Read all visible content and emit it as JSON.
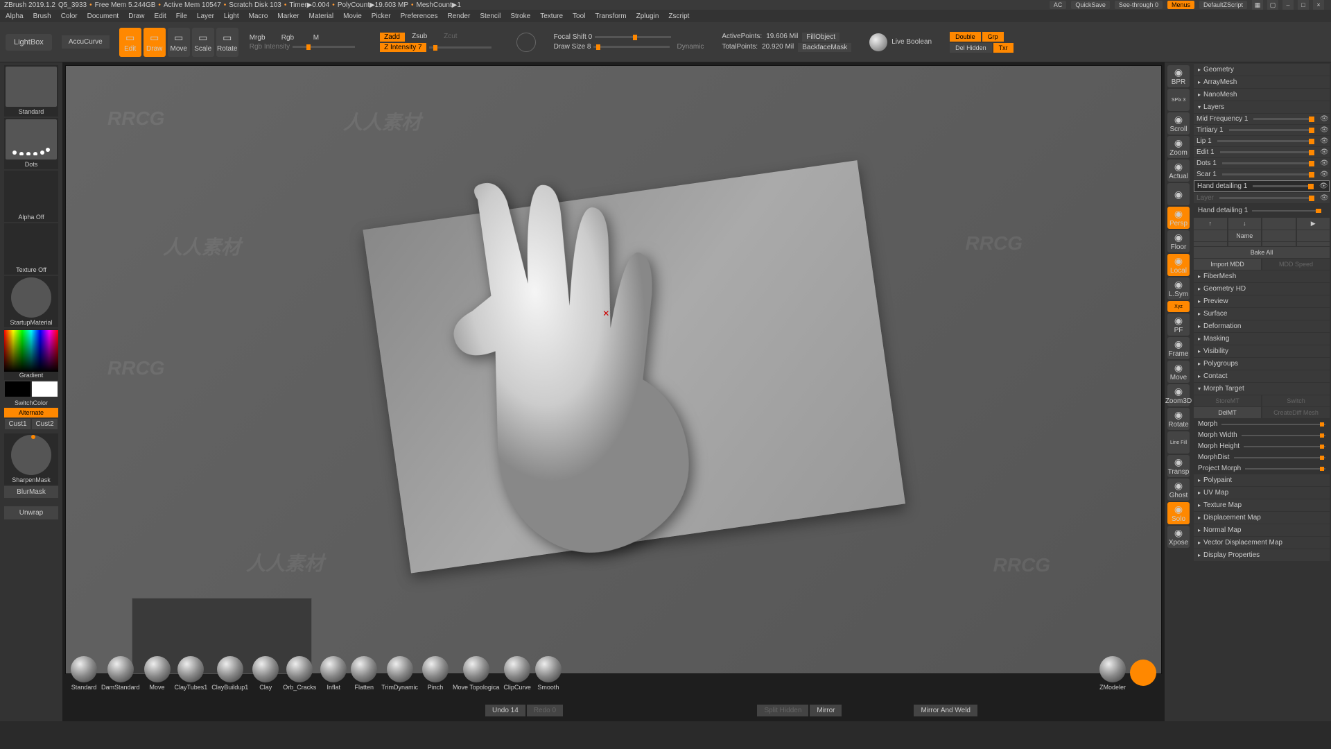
{
  "title": {
    "app": "ZBrush 2019.1.2",
    "file": "Q5_3933",
    "freemem": "Free Mem 5.244GB",
    "activemem": "Active Mem 10547",
    "scratch": "Scratch Disk 103",
    "timer": "Timer▶0.004",
    "polycount": "PolyCount▶19.603 MP",
    "meshcount": "MeshCount▶1"
  },
  "topright": {
    "ac": "AC",
    "quicksave": "QuickSave",
    "seethrough": "See-through  0",
    "menus": "Menus",
    "script": "DefaultZScript"
  },
  "menu": [
    "Alpha",
    "Brush",
    "Color",
    "Document",
    "Draw",
    "Edit",
    "File",
    "Layer",
    "Light",
    "Macro",
    "Marker",
    "Material",
    "Movie",
    "Picker",
    "Preferences",
    "Render",
    "Stencil",
    "Stroke",
    "Texture",
    "Tool",
    "Transform",
    "Zplugin",
    "Zscript"
  ],
  "toolbar": {
    "lightbox": "LightBox",
    "accucurve": "AccuCurve",
    "modes": [
      {
        "label": "Edit",
        "active": true
      },
      {
        "label": "Draw",
        "active": true
      },
      {
        "label": "Move",
        "active": false
      },
      {
        "label": "Scale",
        "active": false
      },
      {
        "label": "Rotate",
        "active": false
      }
    ],
    "color_modes": {
      "mrgb": "Mrgb",
      "rgb": "Rgb",
      "m": "M",
      "rgbintensity": "Rgb Intensity"
    },
    "zmodes": {
      "zadd": "Zadd",
      "zsub": "Zsub",
      "zcut": "Zcut",
      "zintensity": "Z Intensity 7"
    },
    "focal": {
      "label": "Focal Shift 0",
      "draw": "Draw Size 8",
      "dynamic": "Dynamic"
    },
    "stats": {
      "active_lbl": "ActivePoints:",
      "active_val": "19.606 Mil",
      "fill": "FillObject",
      "total_lbl": "TotalPoints:",
      "total_val": "20.920 Mil",
      "backface": "BackfaceMask"
    },
    "livebool": "Live Boolean",
    "rt": {
      "double": "Double",
      "grp": "Grp",
      "delhidden": "Del Hidden",
      "txr": "Txr"
    }
  },
  "left": {
    "standard": "Standard",
    "dots": "Dots",
    "alphaoff": "Alpha Off",
    "textureoff": "Texture Off",
    "startup": "StartupMaterial",
    "gradient": "Gradient",
    "switchcolor": "SwitchColor",
    "alternate": "Alternate",
    "cust1": "Cust1",
    "cust2": "Cust2",
    "sharpen": "SharpenMask",
    "blur": "BlurMask",
    "unwrap": "Unwrap"
  },
  "brushes": [
    "Standard",
    "DamStandard",
    "Move",
    "ClayTubes1",
    "ClayBuildup1",
    "Clay",
    "Orb_Cracks",
    "Inflat",
    "Flatten",
    "TrimDynamic",
    "Pinch",
    "Move Topologica",
    "ClipCurve",
    "Smooth"
  ],
  "brushes_right": [
    "ZModeler",
    ""
  ],
  "undo": {
    "undo": "Undo 14",
    "redo": "Redo 0",
    "split": "Split Hidden",
    "mirror": "Mirror",
    "mirrorweld": "Mirror And Weld"
  },
  "righticons": [
    {
      "lbl": "BPR",
      "o": false
    },
    {
      "lbl": "SPix 3",
      "o": false,
      "text": true
    },
    {
      "lbl": "Scroll",
      "o": false
    },
    {
      "lbl": "Zoom",
      "o": false
    },
    {
      "lbl": "Actual",
      "o": false
    },
    {
      "lbl": "",
      "o": false,
      "lock": true
    },
    {
      "lbl": "Persp",
      "o": true,
      "outlined": true
    },
    {
      "lbl": "Floor",
      "o": false
    },
    {
      "lbl": "Local",
      "o": true
    },
    {
      "lbl": "L.Sym",
      "o": false
    },
    {
      "lbl": "Xyz",
      "o": true,
      "thin": true
    },
    {
      "lbl": "PF",
      "o": false
    },
    {
      "lbl": "Frame",
      "o": false
    },
    {
      "lbl": "Move",
      "o": false
    },
    {
      "lbl": "Zoom3D",
      "o": false
    },
    {
      "lbl": "Rotate",
      "o": false
    },
    {
      "lbl": "Line Fill",
      "o": false,
      "text": true
    },
    {
      "lbl": "Transp",
      "o": false
    },
    {
      "lbl": "Ghost",
      "o": false
    },
    {
      "lbl": "Solo",
      "o": true
    },
    {
      "lbl": "Xpose",
      "o": false
    }
  ],
  "panel": {
    "sections_top": [
      "Geometry",
      "ArrayMesh",
      "NanoMesh"
    ],
    "layers_hdr": "Layers",
    "layers": [
      {
        "name": "Mid Frequency 1",
        "sel": false
      },
      {
        "name": "Tirtiary 1",
        "sel": false
      },
      {
        "name": "Lip 1",
        "sel": false
      },
      {
        "name": "Edit 1",
        "sel": false
      },
      {
        "name": "Dots 1",
        "sel": false
      },
      {
        "name": "Scar 1",
        "sel": false
      },
      {
        "name": "Hand detailing 1",
        "sel": true
      },
      {
        "name": "Layer",
        "sel": false,
        "dim": true
      }
    ],
    "current_layer": "Hand detailing 1",
    "layer_btns1": [
      "↑",
      "↓",
      "",
      "▶"
    ],
    "layer_btns2": [
      "",
      "Name",
      "",
      ""
    ],
    "layer_btns3": [
      "",
      "",
      "",
      ""
    ],
    "bakeall": "Bake All",
    "importmdd": "Import MDD",
    "mddspeed": "MDD Speed",
    "sections_mid": [
      "FiberMesh",
      "Geometry HD",
      "Preview",
      "Surface",
      "Deformation",
      "Masking",
      "Visibility",
      "Polygroups",
      "Contact"
    ],
    "morph_hdr": "Morph Target",
    "morph_btns": [
      [
        "StoreMT",
        "Switch"
      ],
      [
        "DelMT",
        "CreateDiff Mesh"
      ]
    ],
    "morph_sliders": [
      "Morph",
      "Morph Width",
      "Morph Height",
      "MorphDist",
      "Project Morph"
    ],
    "sections_bot": [
      "Polypaint",
      "UV Map",
      "Texture Map",
      "Displacement Map",
      "Normal Map",
      "Vector Displacement Map",
      "Display Properties"
    ]
  },
  "watermark": "人人素材 RRCG"
}
